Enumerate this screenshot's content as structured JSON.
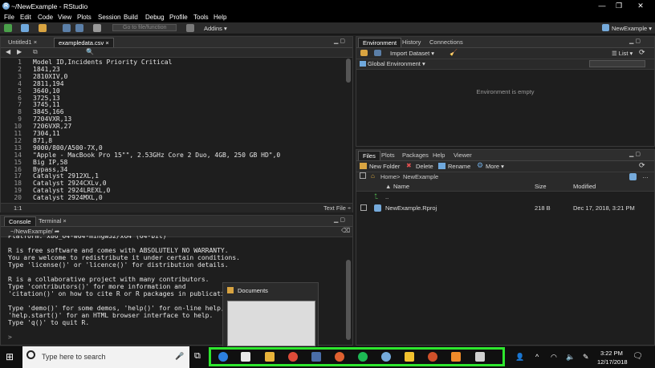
{
  "window": {
    "title": "~/NewExample - RStudio",
    "controls": [
      "—",
      "❐",
      "✕"
    ]
  },
  "menubar": [
    "File",
    "Edit",
    "Code",
    "View",
    "Plots",
    "Session",
    "Build",
    "Debug",
    "Profile",
    "Tools",
    "Help"
  ],
  "toolbar": {
    "goto_placeholder": "Go to file/function",
    "addins_label": "Addins ▾",
    "project_label": "NewExample ▾"
  },
  "editor": {
    "tabs": [
      {
        "label": "Untitled1",
        "active": false
      },
      {
        "label": "exampledata.csv",
        "active": true
      }
    ],
    "lines": [
      {
        "n": "1",
        "text": "Model ID,Incidents Priority Critical"
      },
      {
        "n": "2",
        "text": "1841,23"
      },
      {
        "n": "3",
        "text": "2810XIV,0"
      },
      {
        "n": "4",
        "text": "2811,194"
      },
      {
        "n": "5",
        "text": "3640,10"
      },
      {
        "n": "6",
        "text": "3725,13"
      },
      {
        "n": "7",
        "text": "3745,11"
      },
      {
        "n": "8",
        "text": "3845,166"
      },
      {
        "n": "9",
        "text": "7204VXR,13"
      },
      {
        "n": "10",
        "text": "7206VXR,27"
      },
      {
        "n": "11",
        "text": "7304,11"
      },
      {
        "n": "12",
        "text": "871,8"
      },
      {
        "n": "13",
        "text": "9000/800/A500-7X,0"
      },
      {
        "n": "14",
        "text": "\"Apple - MacBook Pro 15\"\", 2.53GHz Core 2 Duo, 4GB, 250 GB HD\",0"
      },
      {
        "n": "15",
        "text": "Big IP,58"
      },
      {
        "n": "16",
        "text": "Bypass,34"
      },
      {
        "n": "17",
        "text": "Catalyst 2912XL,1"
      },
      {
        "n": "18",
        "text": "Catalyst 2924CXLv,0"
      },
      {
        "n": "19",
        "text": "Catalyst 2924LREXL,0"
      },
      {
        "n": "20",
        "text": "Catalyst 2924MXL,0"
      }
    ],
    "status_position": "1:1",
    "status_type": "Text File ÷"
  },
  "console": {
    "tabs": [
      {
        "label": "Console",
        "active": true
      },
      {
        "label": "Terminal ×",
        "active": false
      }
    ],
    "path": "~/NewExample/ ➦",
    "lines": [
      "Platform: x86_64-w64-mingw32/x64 (64-bit)",
      "",
      "R is free software and comes with ABSOLUTELY NO WARRANTY.",
      "You are welcome to redistribute it under certain conditions.",
      "Type 'license()' or 'licence()' for distribution details.",
      "",
      "R is a collaborative project with many contributors.",
      "Type 'contributors()' for more information and",
      "'citation()' on how to cite R or R packages in publications.",
      "",
      "Type 'demo()' for some demos, 'help()' for on-line help, or",
      "'help.start()' for an HTML browser interface to help.",
      "Type 'q()' to quit R.",
      "",
      ">"
    ]
  },
  "environment": {
    "tabs": [
      {
        "label": "Environment",
        "active": true
      },
      {
        "label": "History",
        "active": false
      },
      {
        "label": "Connections",
        "active": false
      }
    ],
    "import_label": "Import Dataset ▾",
    "list_label": "☰ List ▾",
    "scope_label": "Global Environment ▾",
    "empty_text": "Environment is empty"
  },
  "files": {
    "tabs": [
      {
        "label": "Files",
        "active": true
      },
      {
        "label": "Plots",
        "active": false
      },
      {
        "label": "Packages",
        "active": false
      },
      {
        "label": "Help",
        "active": false
      },
      {
        "label": "Viewer",
        "active": false
      }
    ],
    "actions": {
      "new_folder": "New Folder",
      "delete": "Delete",
      "rename": "Rename",
      "more": "More ▾"
    },
    "breadcrumb_home": "Home",
    "breadcrumb_sep": ">",
    "breadcrumb_folder": "NewExample",
    "columns": {
      "name": "Name",
      "size": "Size",
      "modified": "Modified"
    },
    "parent_label": "..",
    "rows": [
      {
        "name": "NewExample.Rproj",
        "size": "218 B",
        "modified": "Dec 17, 2018, 3:21 PM"
      }
    ]
  },
  "taskbar": {
    "search_placeholder": "Type here to search",
    "popup_label": "Documents",
    "time": "3:22 PM",
    "date": "12/17/2018",
    "highlight_color": "#2ee62e"
  }
}
